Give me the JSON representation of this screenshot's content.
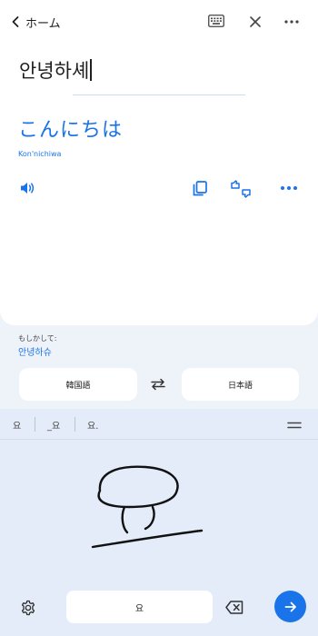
{
  "header": {
    "back_label": "ホーム"
  },
  "translation": {
    "source_text": "안녕하셰",
    "target_text": "こんにちは",
    "romanization": "Kon'nichiwa"
  },
  "suggestion": {
    "hint": "もしかして:",
    "text": "안녕하슈"
  },
  "languages": {
    "source": "韓国語",
    "target": "日本語"
  },
  "handwriting": {
    "candidates": [
      "요",
      "_요",
      "요."
    ],
    "preview": "요"
  },
  "colors": {
    "accent": "#1a73e8",
    "pad_background": "#e3ecf8"
  },
  "icons": [
    "chevron-left-icon",
    "keyboard-icon",
    "close-icon",
    "more-icon",
    "speaker-icon",
    "copy-icon",
    "feedback-icon",
    "swap-icon",
    "collapse-icon",
    "gear-icon",
    "backspace-icon",
    "arrow-right-icon"
  ]
}
